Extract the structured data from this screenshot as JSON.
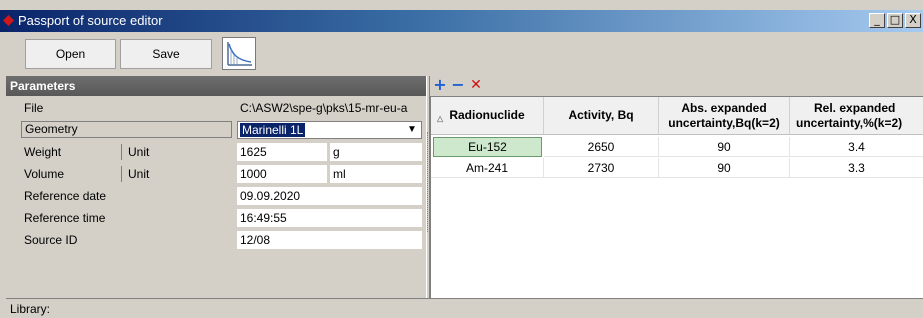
{
  "window": {
    "title": "Passport of source editor",
    "controls": {
      "minimize": "_",
      "maximize": "□",
      "close": "X"
    }
  },
  "toolbar": {
    "open_label": "Open",
    "save_label": "Save",
    "chart_icon": "curve-chart-icon"
  },
  "parameters": {
    "header": "Parameters",
    "file": {
      "label": "File",
      "value": "C:\\ASW2\\spe-g\\pks\\15-mr-eu-a"
    },
    "geometry": {
      "label": "Geometry",
      "value": "Marinelli 1L"
    },
    "weight": {
      "label": "Weight",
      "unit_label": "Unit",
      "value": "1625",
      "unit": "g"
    },
    "volume": {
      "label": "Volume",
      "unit_label": "Unit",
      "value": "1000",
      "unit": "ml"
    },
    "reference_date": {
      "label": "Reference date",
      "value": "09.09.2020"
    },
    "reference_time": {
      "label": "Reference time",
      "value": "16:49:55"
    },
    "source_id": {
      "label": "Source ID",
      "value": "12/08"
    }
  },
  "grid_toolbar": {
    "add": "+",
    "remove": "−",
    "delete": "✕",
    "colors": {
      "add": "#1e5fd6",
      "remove": "#1e5fd6",
      "delete": "#d01010"
    }
  },
  "table": {
    "headers": {
      "radionuclide": "Radionuclide",
      "activity": "Activity, Bq",
      "abs1": "Abs. expanded",
      "abs2": "uncertainty,Bq(k=2)",
      "rel1": "Rel. expanded",
      "rel2": "uncertainty,%(k=2)"
    },
    "rows": [
      {
        "radionuclide": "Eu-152",
        "activity": "2650",
        "abs": "90",
        "rel": "3.4"
      },
      {
        "radionuclide": "Am-241",
        "activity": "2730",
        "abs": "90",
        "rel": "3.3"
      }
    ]
  },
  "status": {
    "library": "Library:"
  }
}
